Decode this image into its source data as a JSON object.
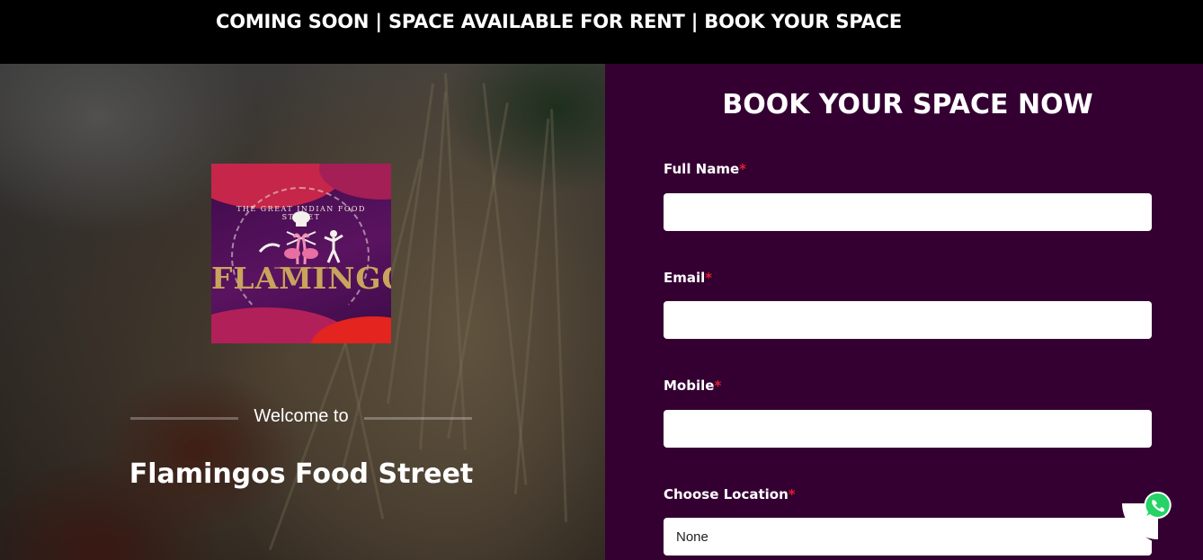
{
  "announcement": {
    "text": "COMING SOON | SPACE AVAILABLE FOR RENT | BOOK YOUR SPACE"
  },
  "hero": {
    "logo": {
      "tagline": "THE GREAT INDIAN FOOD STREET",
      "wordmark": "FLAMINGOS"
    },
    "welcome_text": "Welcome to",
    "venue_name": "Flamingos Food Street"
  },
  "form": {
    "title": "BOOK YOUR SPACE NOW",
    "required_marker": "*",
    "fields": {
      "full_name": {
        "label": "Full Name",
        "value": ""
      },
      "email": {
        "label": "Email",
        "value": ""
      },
      "mobile": {
        "label": "Mobile",
        "value": ""
      },
      "location": {
        "label": "Choose Location",
        "selected": "None"
      }
    }
  },
  "floating": {
    "whatsapp_icon": "whatsapp-icon"
  },
  "colors": {
    "topbar_bg": "#000000",
    "form_bg": "#340032",
    "required_star": "#e0202a",
    "whatsapp_green": "#25d366"
  }
}
